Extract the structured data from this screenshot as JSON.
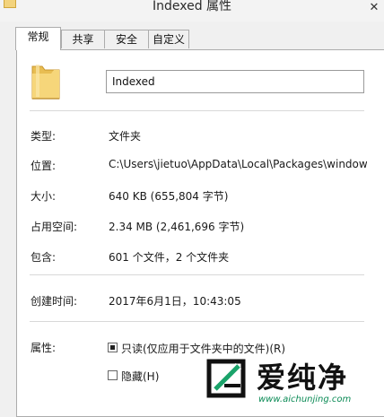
{
  "window": {
    "title": "Indexed 属性",
    "close_icon": "close-icon"
  },
  "tabs": [
    {
      "label": "常规",
      "active": true
    },
    {
      "label": "共享",
      "active": false
    },
    {
      "label": "安全",
      "active": false
    },
    {
      "label": "自定义",
      "active": false
    }
  ],
  "general": {
    "folder_icon": "folder-icon",
    "name_value": "Indexed",
    "type": {
      "label": "类型:",
      "value": "文件夹"
    },
    "location": {
      "label": "位置:",
      "value": "C:\\Users\\jietuo\\AppData\\Local\\Packages\\window"
    },
    "size": {
      "label": "大小:",
      "value": "640 KB (655,804 字节)"
    },
    "size_on_disk": {
      "label": "占用空间:",
      "value": "2.34 MB (2,461,696 字节)"
    },
    "contains": {
      "label": "包含:",
      "value": "601 个文件，2 个文件夹"
    },
    "created": {
      "label": "创建时间:",
      "value": "2017年6月1日，10:43:05"
    },
    "attributes": {
      "label": "属性:",
      "readonly": {
        "label": "只读(仅应用于文件夹中的文件)(R)",
        "state": "indeterminate"
      },
      "hidden": {
        "label": "隐藏(H)",
        "state": "unchecked"
      }
    }
  },
  "watermark": {
    "name": "爱纯净",
    "url": "www.aichunjing.com",
    "accent_color": "#0a8a55"
  }
}
